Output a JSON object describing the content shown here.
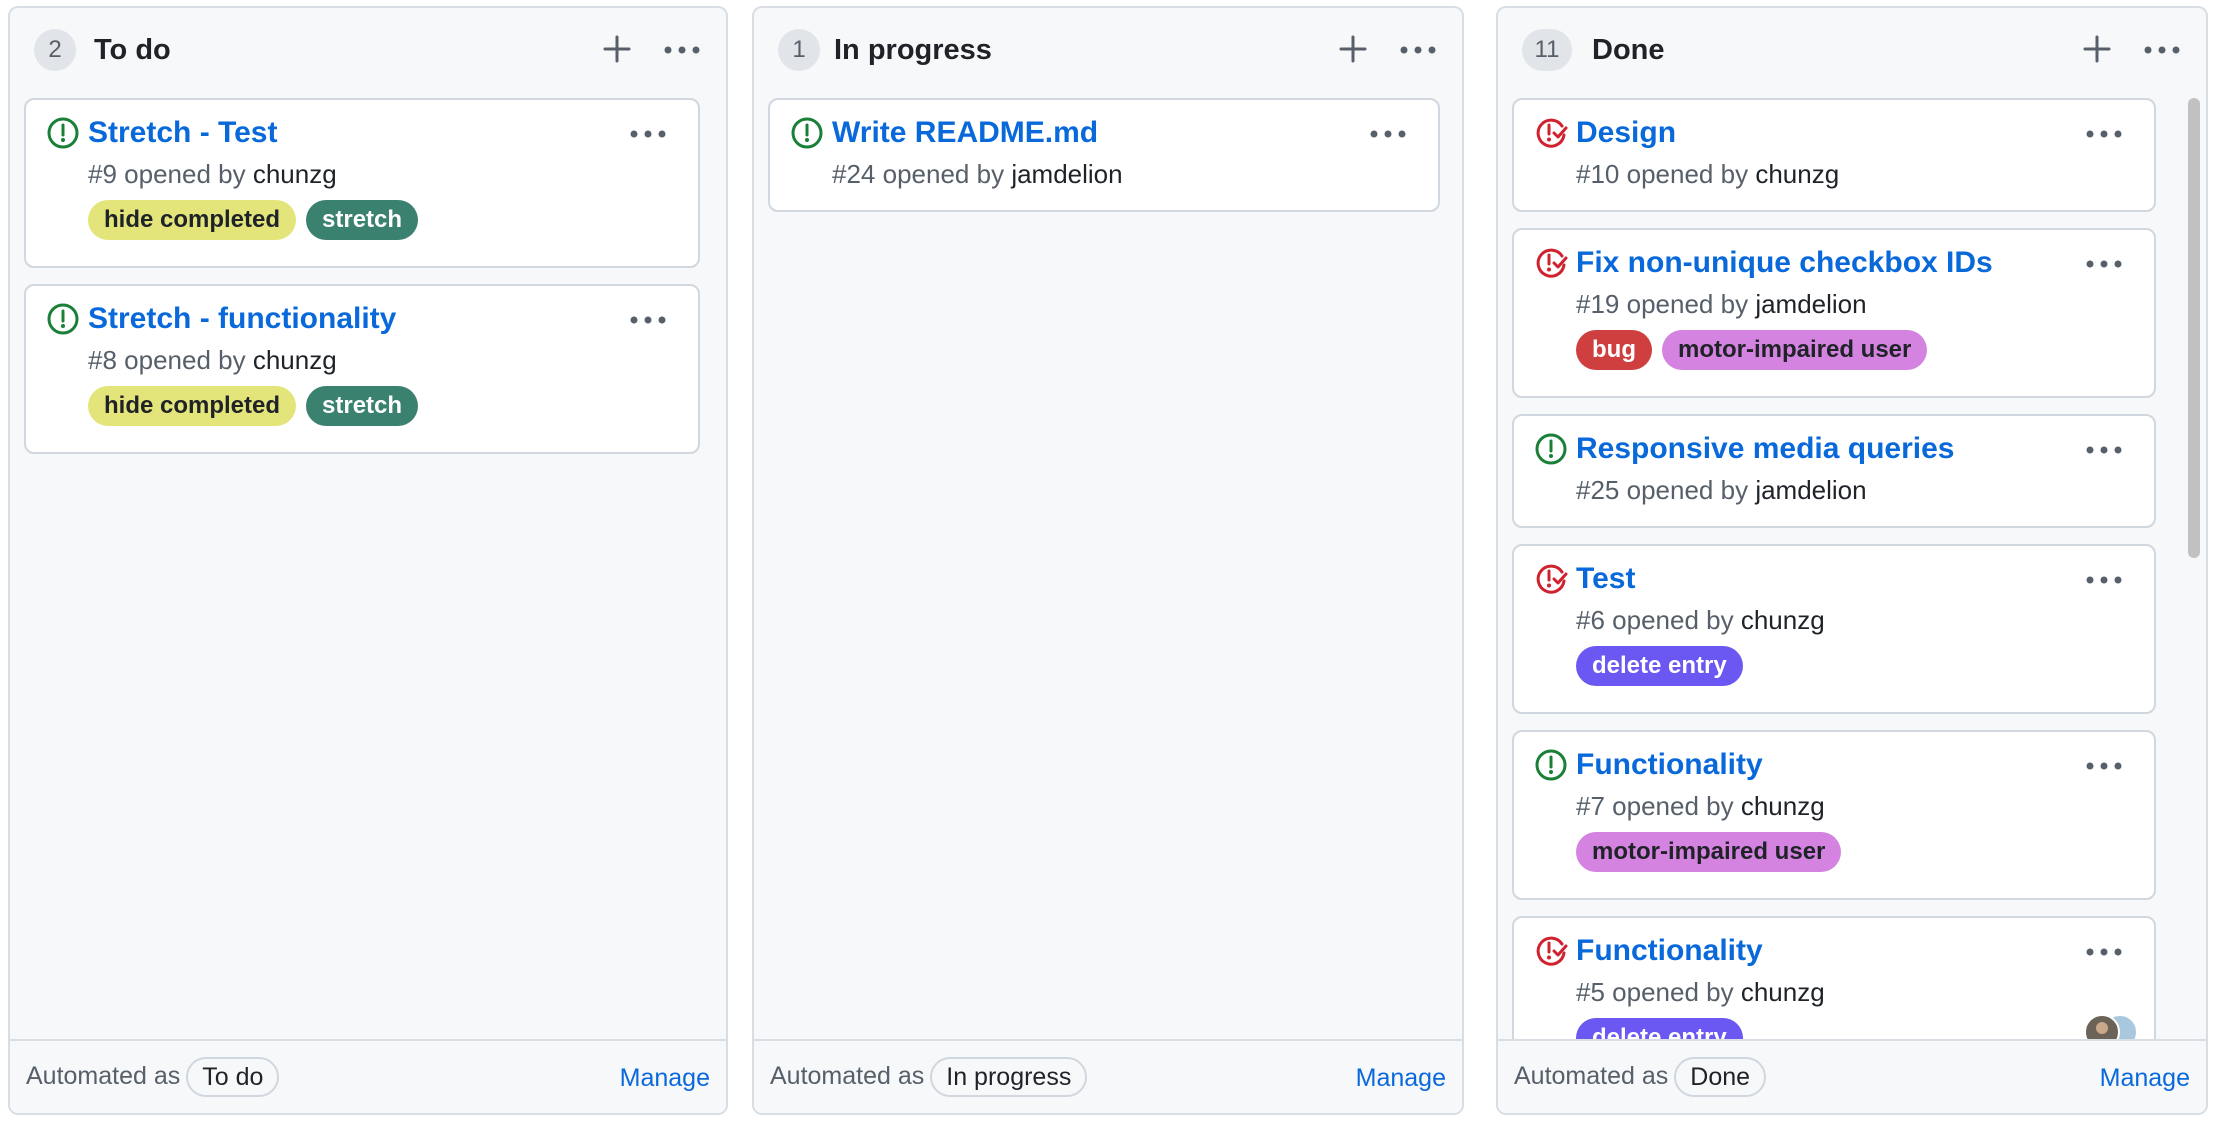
{
  "columns": [
    {
      "count": "2",
      "title": "To do",
      "automated_label": "Automated as",
      "automation": "To do",
      "manage_label": "Manage",
      "cards": [
        {
          "title": "Stretch - Test",
          "number": "#9",
          "opened_by": "opened by",
          "author": "chunzg",
          "state": "open",
          "labels": [
            {
              "text": "hide completed",
              "bg": "#e3e57a",
              "fg": "#1f2328"
            },
            {
              "text": "stretch",
              "bg": "#3b8170",
              "fg": "#ffffff"
            }
          ]
        },
        {
          "title": "Stretch - functionality",
          "number": "#8",
          "opened_by": "opened by",
          "author": "chunzg",
          "state": "open",
          "labels": [
            {
              "text": "hide completed",
              "bg": "#e3e57a",
              "fg": "#1f2328"
            },
            {
              "text": "stretch",
              "bg": "#3b8170",
              "fg": "#ffffff"
            }
          ]
        }
      ]
    },
    {
      "count": "1",
      "title": "In progress",
      "automated_label": "Automated as",
      "automation": "In progress",
      "manage_label": "Manage",
      "cards": [
        {
          "title": "Write README.md",
          "number": "#24",
          "opened_by": "opened by",
          "author": "jamdelion",
          "state": "open",
          "labels": []
        }
      ]
    },
    {
      "count": "11",
      "title": "Done",
      "automated_label": "Automated as",
      "automation": "Done",
      "manage_label": "Manage",
      "cards": [
        {
          "title": "Design",
          "number": "#10",
          "opened_by": "opened by",
          "author": "chunzg",
          "state": "closed",
          "labels": []
        },
        {
          "title": "Fix non-unique checkbox IDs",
          "number": "#19",
          "opened_by": "opened by",
          "author": "jamdelion",
          "state": "closed",
          "labels": [
            {
              "text": "bug",
              "bg": "#cf3f3f",
              "fg": "#ffffff"
            },
            {
              "text": "motor-impaired user",
              "bg": "#d483e0",
              "fg": "#1f2328"
            }
          ]
        },
        {
          "title": "Responsive media queries",
          "number": "#25",
          "opened_by": "opened by",
          "author": "jamdelion",
          "state": "open",
          "labels": []
        },
        {
          "title": "Test",
          "number": "#6",
          "opened_by": "opened by",
          "author": "chunzg",
          "state": "closed",
          "labels": [
            {
              "text": "delete entry",
              "bg": "#6b57f2",
              "fg": "#ffffff"
            }
          ]
        },
        {
          "title": "Functionality",
          "number": "#7",
          "opened_by": "opened by",
          "author": "chunzg",
          "state": "open",
          "labels": [
            {
              "text": "motor-impaired user",
              "bg": "#d483e0",
              "fg": "#1f2328"
            }
          ]
        },
        {
          "title": "Functionality",
          "number": "#5",
          "opened_by": "opened by",
          "author": "chunzg",
          "state": "closed",
          "labels": [
            {
              "text": "delete entry",
              "bg": "#6b57f2",
              "fg": "#ffffff"
            }
          ],
          "has_avatars": true
        }
      ]
    }
  ],
  "icons": {
    "open_issue": "issue-opened-icon",
    "closed_issue": "issue-closed-icon",
    "add": "plus-icon",
    "more": "kebab-horizontal-icon",
    "avatars": "avatar-stack-icon"
  },
  "colors": {
    "link": "#0969da",
    "open_green": "#1a7f37",
    "closed_red": "#cf222e",
    "column_bg": "#f6f8fa"
  }
}
